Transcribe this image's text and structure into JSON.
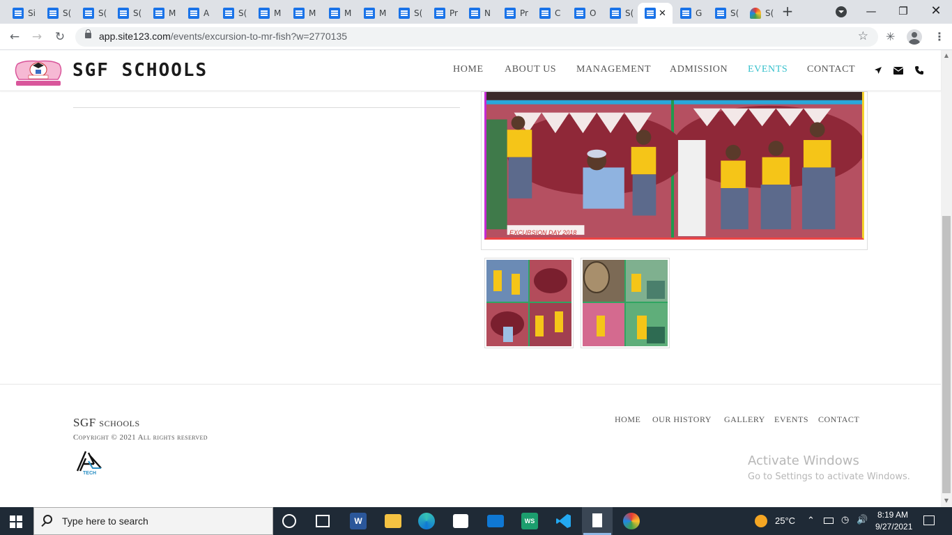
{
  "browser": {
    "tabs": [
      {
        "label": "Si",
        "icon": "docs-icon"
      },
      {
        "label": "S(",
        "icon": "docs-icon"
      },
      {
        "label": "S(",
        "icon": "docs-icon"
      },
      {
        "label": "S(",
        "icon": "docs-icon"
      },
      {
        "label": "M",
        "icon": "docs-icon"
      },
      {
        "label": "A",
        "icon": "docs-icon"
      },
      {
        "label": "S(",
        "icon": "docs-icon"
      },
      {
        "label": "M",
        "icon": "docs-icon"
      },
      {
        "label": "M",
        "icon": "docs-icon"
      },
      {
        "label": "M",
        "icon": "docs-icon"
      },
      {
        "label": "M",
        "icon": "docs-icon"
      },
      {
        "label": "S(",
        "icon": "docs-icon"
      },
      {
        "label": "Pr",
        "icon": "docs-icon"
      },
      {
        "label": "N",
        "icon": "docs-icon"
      },
      {
        "label": "Pr",
        "icon": "docs-icon"
      },
      {
        "label": "C",
        "icon": "docs-icon"
      },
      {
        "label": "O",
        "icon": "docs-icon"
      },
      {
        "label": "S(",
        "icon": "docs-icon"
      },
      {
        "label": "",
        "icon": "docs-icon",
        "active": true
      },
      {
        "label": "G",
        "icon": "docs-icon"
      },
      {
        "label": "S(",
        "icon": "docs-icon"
      },
      {
        "label": "S(",
        "icon": "rainbow-icon"
      }
    ],
    "url_host": "app.site123.com",
    "url_path": "/events/excursion-to-mr-fish?w=2770135"
  },
  "site": {
    "brand": "SGF SCHOOLS",
    "nav": [
      "HOME",
      "ABOUT US",
      "MANAGEMENT",
      "ADMISSION",
      "EVENTS",
      "CONTACT"
    ],
    "active_nav": "EVENTS",
    "accent_color": "#35c0cc"
  },
  "gallery": {
    "main_caption": "EXCURSION DAY 2018"
  },
  "footer": {
    "brand": "SGF schools",
    "copyright": "Copyright © 2021 All rights reserved",
    "logo_text": "TECH",
    "nav": [
      "HOME",
      "OUR HISTORY",
      "GALLERY",
      "EVENTS",
      "CONTACT"
    ]
  },
  "watermark": {
    "line1": "Activate Windows",
    "line2": "Go to Settings to activate Windows."
  },
  "taskbar": {
    "search_placeholder": "Type here to search",
    "temperature": "25°C",
    "time": "8:19 AM",
    "date": "9/27/2021"
  }
}
